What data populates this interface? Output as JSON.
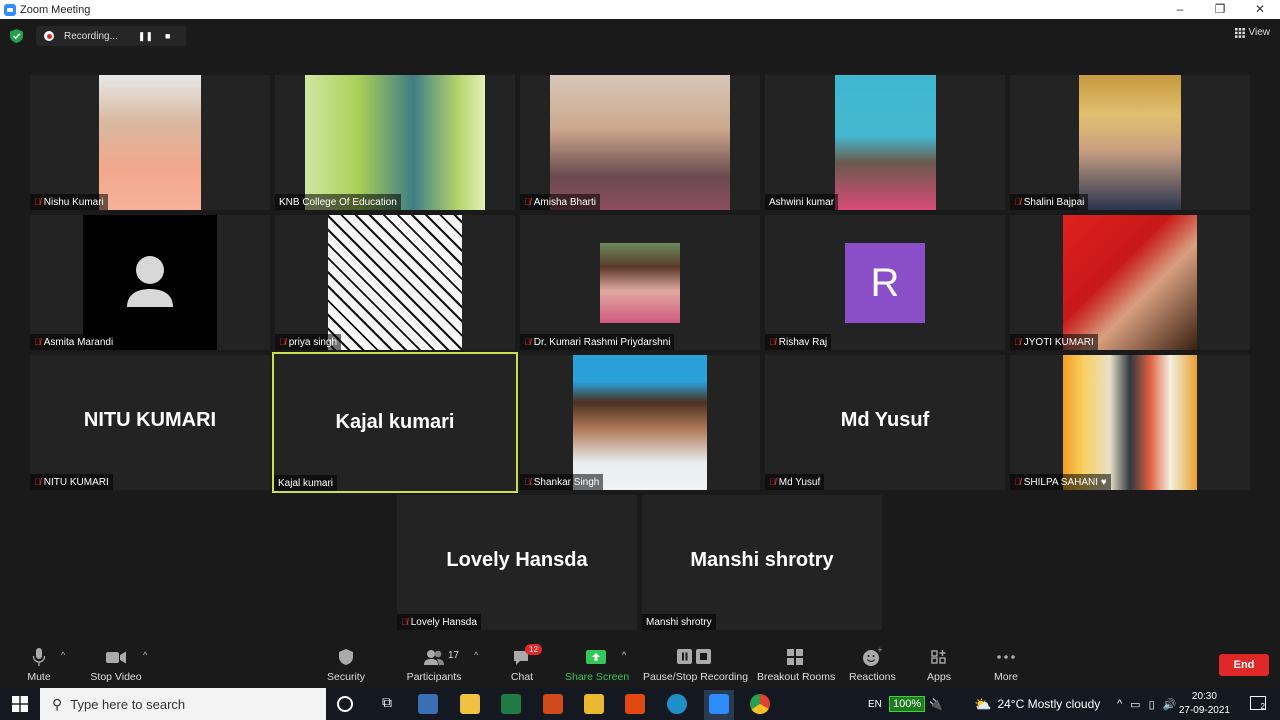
{
  "window": {
    "title": "Zoom Meeting",
    "controls": [
      "–",
      "❐",
      "✕"
    ]
  },
  "recording": {
    "label": "Recording..."
  },
  "view_button": {
    "label": "View"
  },
  "tiles": [
    {
      "name": "Nishu Kumari",
      "muted": true
    },
    {
      "name": "KNB College Of Education",
      "muted": false
    },
    {
      "name": "Amisha Bharti",
      "muted": true
    },
    {
      "name": "Ashwini kumar",
      "muted": false
    },
    {
      "name": "Shalini Bajpai",
      "muted": true
    },
    {
      "name": "Asmita Marandi",
      "muted": true
    },
    {
      "name": "priya singh",
      "muted": true
    },
    {
      "name": "Dr. Kumari Rashmi Priydarshni",
      "muted": true
    },
    {
      "name": "Rishav Raj",
      "muted": true,
      "avatar_letter": "R"
    },
    {
      "name": "JYOTI KUMARI",
      "muted": true
    },
    {
      "name": "NITU KUMARI",
      "muted": true,
      "display": "NITU KUMARI"
    },
    {
      "name": "Kajal kumari",
      "muted": false,
      "display": "Kajal kumari",
      "active": true
    },
    {
      "name": "Shankar Singh",
      "muted": true
    },
    {
      "name": "Md Yusuf",
      "muted": true,
      "display": "Md Yusuf"
    },
    {
      "name": "SHILPA SAHANI ♥",
      "muted": true
    },
    {
      "name": "Lovely Hansda",
      "muted": true,
      "display": "Lovely Hansda"
    },
    {
      "name": "Manshi shrotry",
      "muted": false,
      "display": "Manshi shrotry"
    }
  ],
  "toolbar": {
    "mute": "Mute",
    "stop_video": "Stop Video",
    "security": "Security",
    "participants": "Participants",
    "participants_count": "17",
    "chat": "Chat",
    "chat_badge": "12",
    "share_screen": "Share Screen",
    "pause_stop_recording": "Pause/Stop Recording",
    "breakout_rooms": "Breakout Rooms",
    "reactions": "Reactions",
    "apps": "Apps",
    "more": "More",
    "end": "End"
  },
  "taskbar": {
    "search_placeholder": "Type here to search",
    "language": "EN",
    "battery": "100%",
    "weather": "24°C  Mostly cloudy",
    "time": "20:30",
    "date": "27-09-2021",
    "notifications": "2"
  },
  "colors": {
    "active_border": "#c8e04a",
    "end_button": "#e02828",
    "share_green": "#34c759",
    "avatar_purple": "#8a4fc8"
  }
}
